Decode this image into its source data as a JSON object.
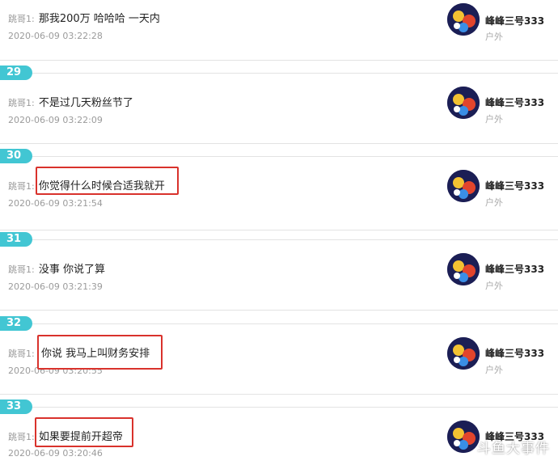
{
  "items": [
    {
      "number": "",
      "prefix": "跳哥1:",
      "text": "那我200万 哈哈哈 一天内",
      "time": "2020-06-09 03:22:28",
      "user": "峰峰三号333",
      "tag": "户外",
      "highlighted": false
    },
    {
      "number": "29",
      "prefix": "跳哥1:",
      "text": "不是过几天粉丝节了",
      "time": "2020-06-09 03:22:09",
      "user": "峰峰三号333",
      "tag": "户外",
      "highlighted": false
    },
    {
      "number": "30",
      "prefix": "跳哥1:",
      "text": "你觉得什么时候合适我就开",
      "time": "2020-06-09 03:21:54",
      "user": "峰峰三号333",
      "tag": "户外",
      "highlighted": true
    },
    {
      "number": "31",
      "prefix": "跳哥1:",
      "text": "没事 你说了算",
      "time": "2020-06-09 03:21:39",
      "user": "峰峰三号333",
      "tag": "户外",
      "highlighted": false
    },
    {
      "number": "32",
      "prefix": "跳哥1:",
      "text": "你说 我马上叫财务安排",
      "time": "2020-06-09 03:20:55",
      "user": "峰峰三号333",
      "tag": "户外",
      "highlighted": true
    },
    {
      "number": "33",
      "prefix": "跳哥1:",
      "text": "如果要提前开超帝",
      "time": "2020-06-09 03:20:46",
      "user": "峰峰三号333",
      "tag": "",
      "highlighted": true
    }
  ],
  "watermark": "斗鱼大事件",
  "colors": {
    "badge": "#42c6d3",
    "highlight_box": "#d9322c"
  }
}
